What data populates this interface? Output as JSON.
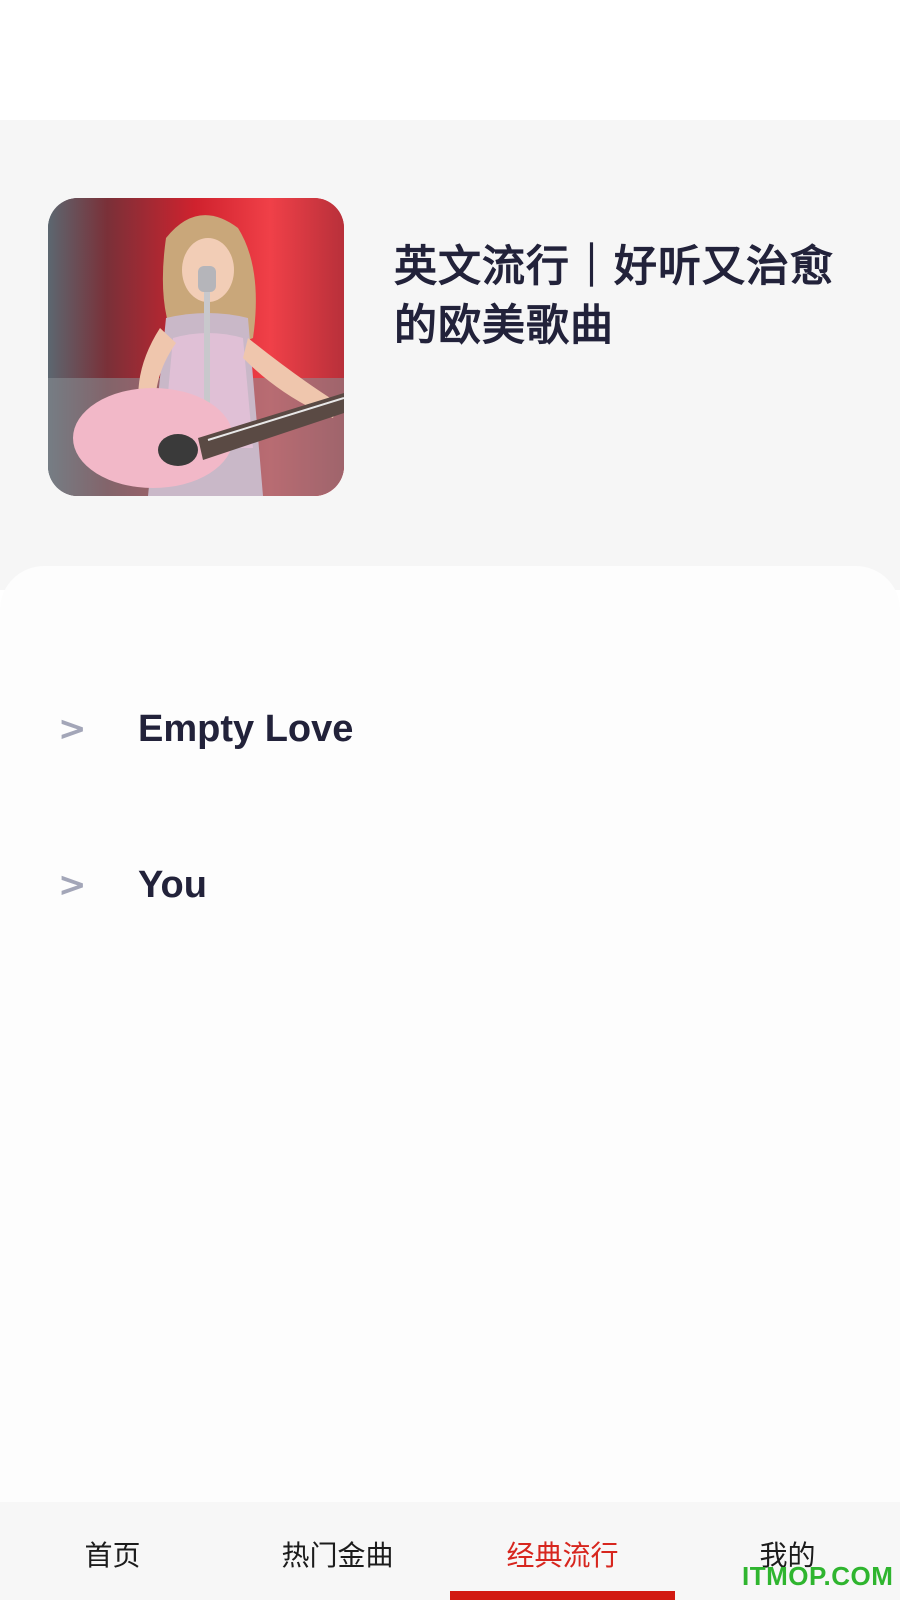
{
  "playlist": {
    "title": "英文流行｜好听又治愈的欧美歌曲",
    "cover_alt": "singer-with-pink-guitar"
  },
  "songs": [
    {
      "arrow": ">",
      "name": "Empty Love"
    },
    {
      "arrow": ">",
      "name": "You"
    }
  ],
  "tabs": [
    {
      "label": "首页",
      "active": false
    },
    {
      "label": "热门金曲",
      "active": false
    },
    {
      "label": "经典流行",
      "active": true
    },
    {
      "label": "我的",
      "active": false
    }
  ],
  "watermark": "ITMOP.COM",
  "colors": {
    "accent": "#d7261e",
    "title_text": "#22223a",
    "arrow": "#a3a6b8",
    "watermark": "#2fb52f"
  }
}
